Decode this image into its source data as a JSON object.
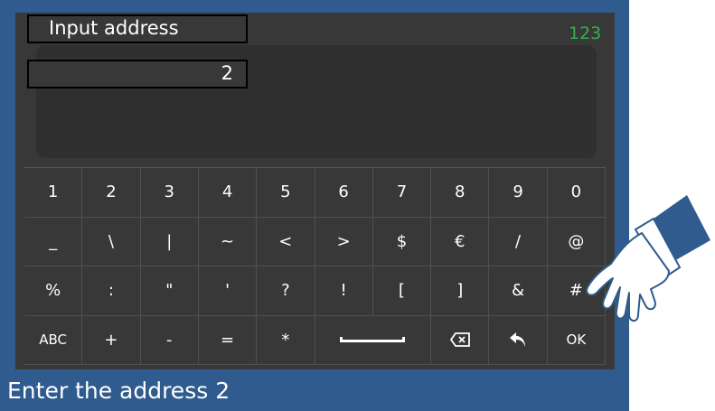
{
  "header": {
    "title": "Input address",
    "mode_label": "123"
  },
  "input": {
    "value": "2"
  },
  "keyboard": {
    "row1": [
      "1",
      "2",
      "3",
      "4",
      "5",
      "6",
      "7",
      "8",
      "9",
      "0"
    ],
    "row2": [
      "_",
      "\\",
      "|",
      "~",
      "<",
      ">",
      "$",
      "€",
      "/",
      "@"
    ],
    "row3": [
      "%",
      ":",
      "\"",
      "'",
      "?",
      "!",
      "[",
      "]",
      "&",
      "#"
    ],
    "row4": {
      "abc": "ABC",
      "plus": "+",
      "minus": "-",
      "equals": "=",
      "star": "*",
      "ok": "OK"
    }
  },
  "caption": "Enter the address 2",
  "colors": {
    "frame": "#2f5b8e",
    "screen": "#383838",
    "mode": "#34b14b"
  },
  "icons": [
    "space-bar-icon",
    "backspace-icon",
    "back-arrow-icon",
    "pointing-hand-icon"
  ]
}
